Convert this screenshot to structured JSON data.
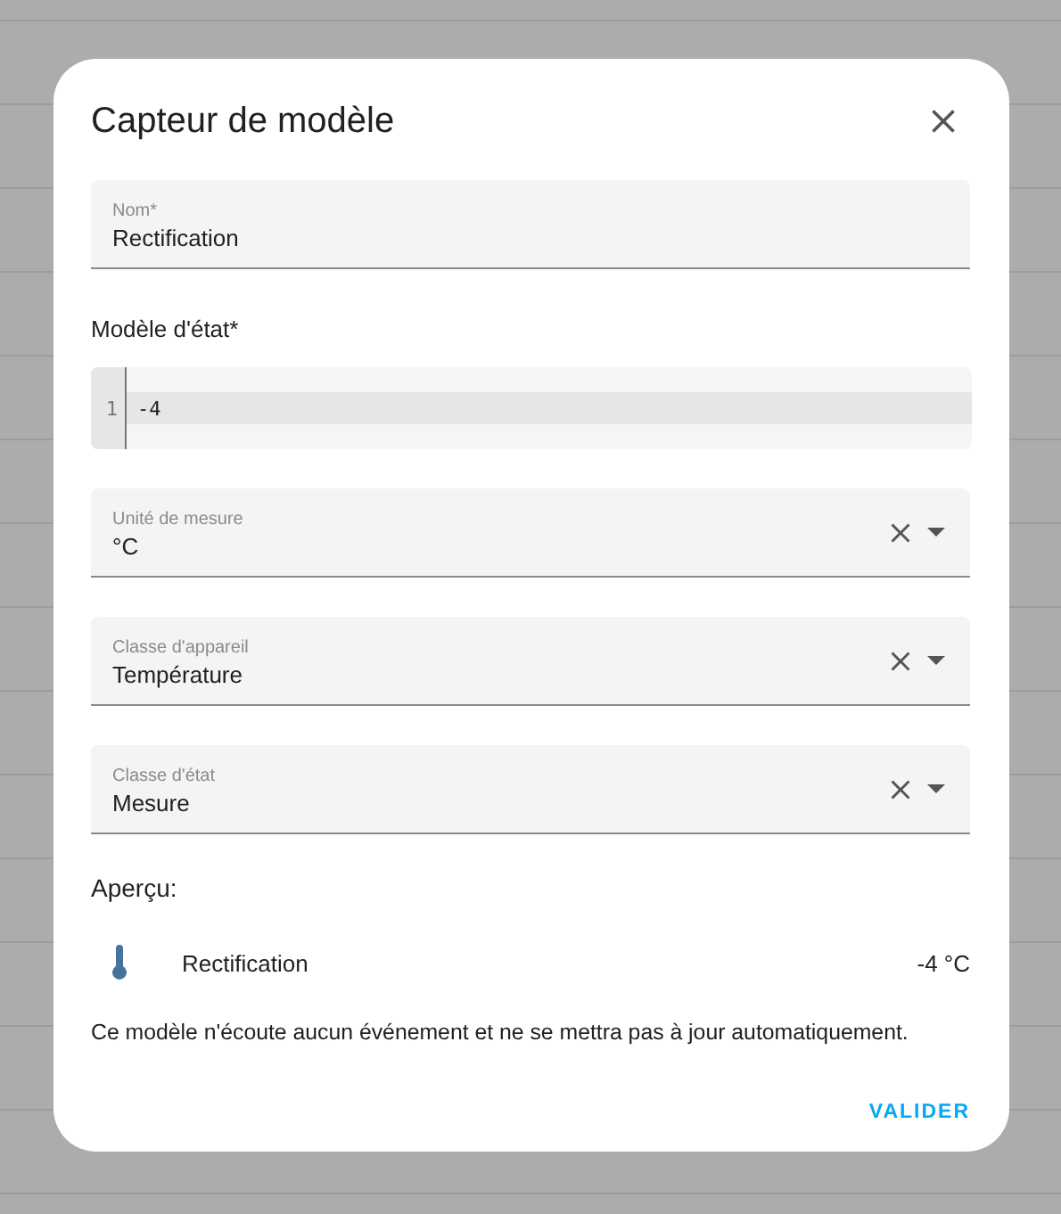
{
  "dialog": {
    "title": "Capteur de modèle",
    "name_field": {
      "label": "Nom*",
      "value": "Rectification"
    },
    "template_label": "Modèle d'état*",
    "editor": {
      "lines": [
        {
          "number": "1",
          "code": "-4",
          "active": true
        }
      ]
    },
    "selects": [
      {
        "label": "Unité de mesure",
        "value": "°C"
      },
      {
        "label": "Classe d'appareil",
        "value": "Température"
      },
      {
        "label": "Classe d'état",
        "value": "Mesure"
      }
    ],
    "preview_label": "Aperçu:",
    "preview": {
      "name": "Rectification",
      "state": "-4 °C"
    },
    "note": "Ce modèle n'écoute aucun événement et ne se mettra pas à jour automatiquement.",
    "buttons": [
      "VALIDER"
    ]
  }
}
